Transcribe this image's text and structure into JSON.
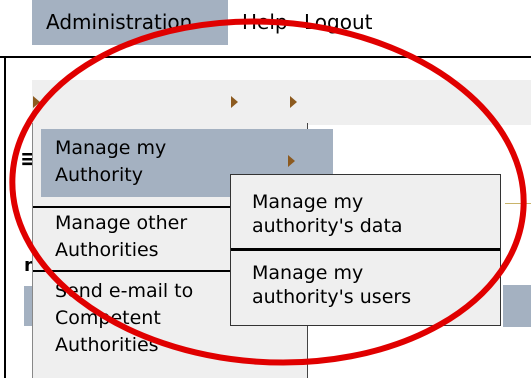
{
  "menubar": {
    "items": [
      {
        "label": "Administration"
      },
      {
        "label": "Help"
      },
      {
        "label": "Logout"
      }
    ]
  },
  "dropdown": {
    "items": [
      {
        "label_line1": "Manage my",
        "label_line2": "Authority"
      },
      {
        "label_line1": "Manage other",
        "label_line2": "Authorities"
      },
      {
        "label_line1": "Send e-mail to",
        "label_line2": "Competent",
        "label_line3": "Authorities"
      }
    ]
  },
  "submenu": {
    "items": [
      {
        "label_line1": "Manage my",
        "label_line2": "authority's data"
      },
      {
        "label_line1": "Manage my",
        "label_line2": "authority's users"
      }
    ]
  },
  "background": {
    "symbol": "≡",
    "letter": "n"
  },
  "colors": {
    "menu_bg": "#efefef",
    "highlight": "#a4b1c1",
    "arrow": "#8c5a1f",
    "annotation": "#e00000"
  },
  "icons": {
    "menu_arrow": "right-triangle-icon"
  }
}
